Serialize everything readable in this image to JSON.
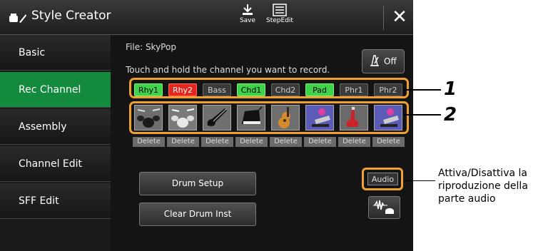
{
  "window": {
    "title": "Style Creator",
    "save_label": "Save",
    "stepedit_label": "StepEdit",
    "close_symbol": "✕"
  },
  "sidebar": {
    "items": [
      {
        "label": "Basic",
        "active": false
      },
      {
        "label": "Rec Channel",
        "active": true
      },
      {
        "label": "Assembly",
        "active": false
      },
      {
        "label": "Channel Edit",
        "active": false
      },
      {
        "label": "SFF Edit",
        "active": false
      }
    ]
  },
  "main": {
    "file_label": "File: SkyPop",
    "instruction": "Touch and hold the channel you want to record.",
    "metronome_label": "Off",
    "channels": [
      {
        "label": "Rhy1",
        "state": "green"
      },
      {
        "label": "Rhy2",
        "state": "red"
      },
      {
        "label": "Bass",
        "state": "off"
      },
      {
        "label": "Chd1",
        "state": "green"
      },
      {
        "label": "Chd2",
        "state": "off"
      },
      {
        "label": "Pad",
        "state": "green"
      },
      {
        "label": "Phr1",
        "state": "off"
      },
      {
        "label": "Phr2",
        "state": "off"
      }
    ],
    "voice_icons": [
      "drum-kit-icon",
      "drum-kit-icon",
      "electric-bass-icon",
      "piano-icon",
      "acoustic-guitar-icon",
      "keyboard-player-icon",
      "electric-guitar-icon",
      "keyboard-player-icon"
    ],
    "delete_label": "Delete",
    "drum_setup_label": "Drum Setup",
    "clear_drum_label": "Clear Drum Inst",
    "audio_label": "Audio"
  },
  "annotations": {
    "callout_1": "1",
    "callout_2": "2",
    "audio_note": "Attiva/Disattiva la riproduzione della parte audio"
  },
  "colors": {
    "accent_green": "#138a3c",
    "channel_on": "#3fd24a",
    "channel_rec": "#e5261e",
    "highlight_frame": "#f0a030"
  }
}
